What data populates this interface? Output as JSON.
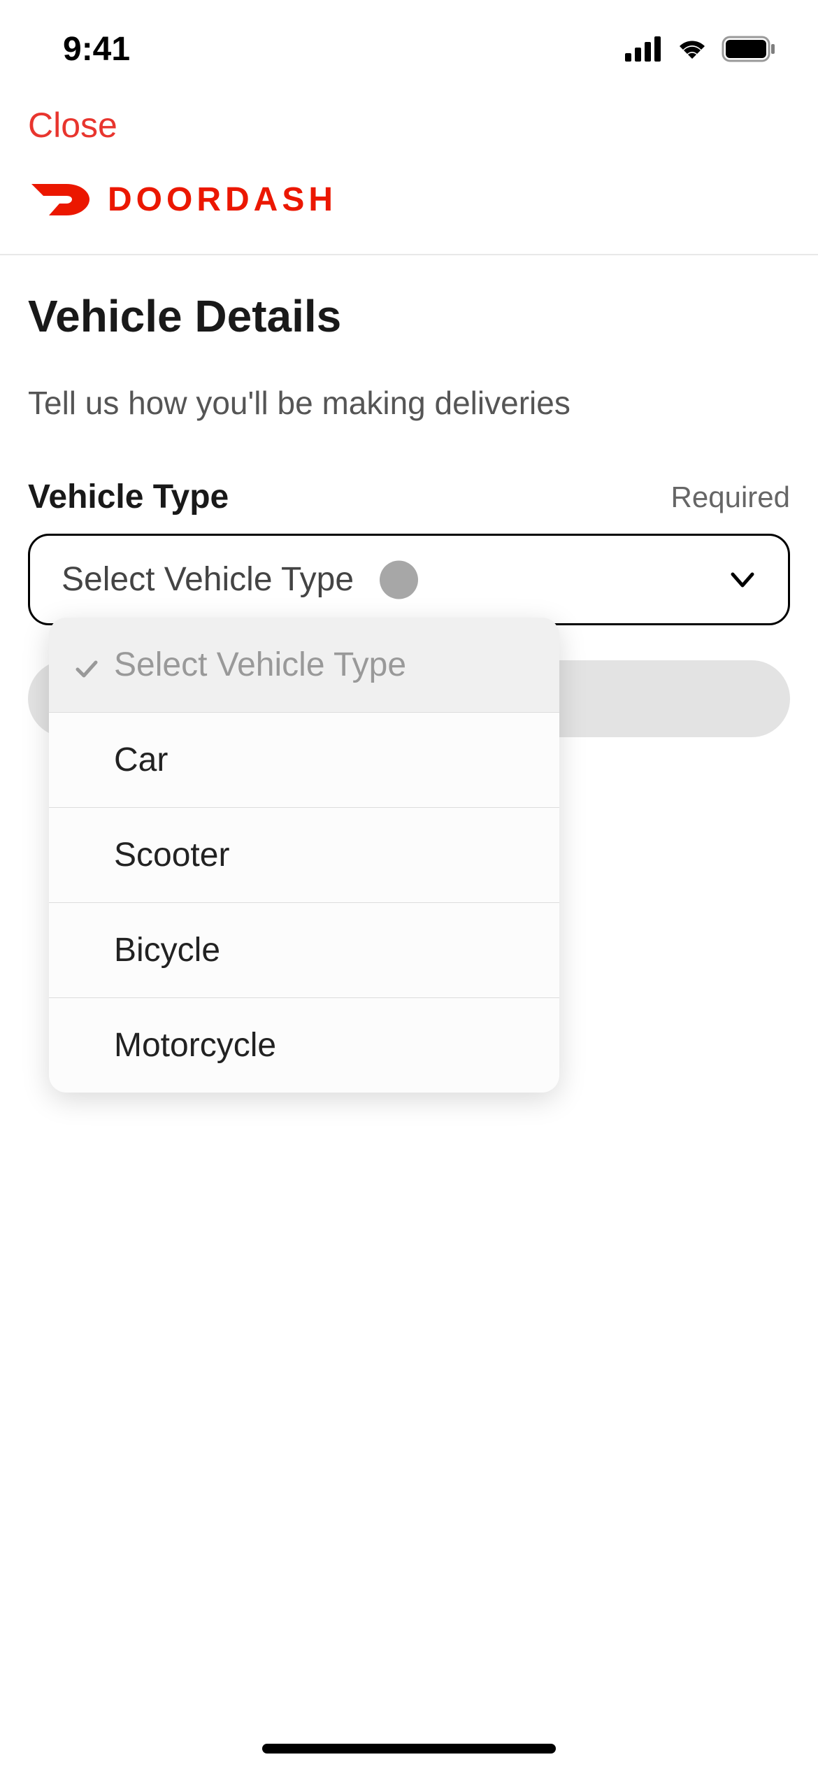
{
  "status_bar": {
    "time": "9:41"
  },
  "header": {
    "close_label": "Close"
  },
  "logo": {
    "text": "DOORDASH"
  },
  "page": {
    "title": "Vehicle Details",
    "subtitle": "Tell us how you'll be making deliveries"
  },
  "field": {
    "label": "Vehicle Type",
    "required_text": "Required",
    "placeholder": "Select Vehicle Type"
  },
  "dropdown": {
    "placeholder_option": "Select Vehicle Type",
    "options": [
      "Car",
      "Scooter",
      "Bicycle",
      "Motorcycle"
    ]
  }
}
